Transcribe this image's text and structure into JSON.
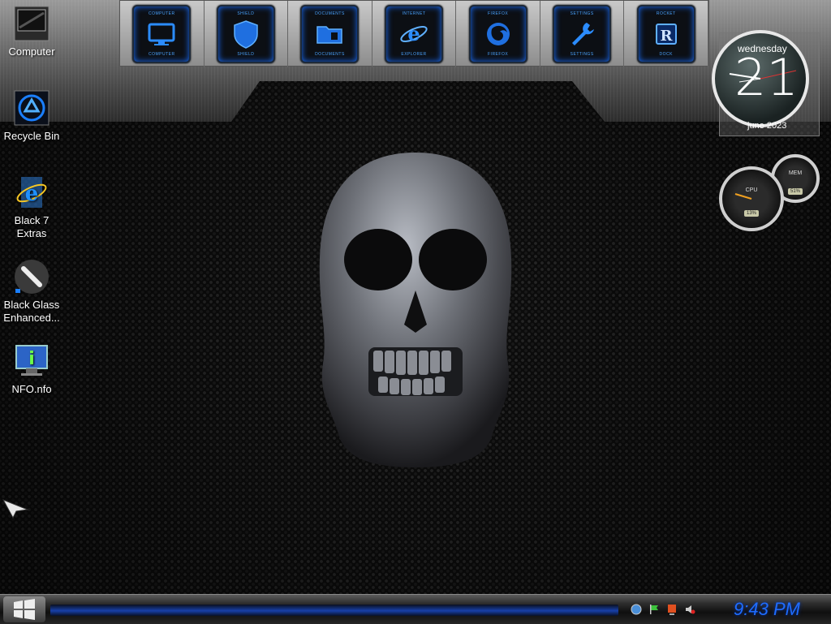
{
  "desktop": {
    "icons": [
      {
        "label": "Computer",
        "icon": "monitor-icon"
      },
      {
        "label": "Recycle Bin",
        "icon": "recycle-icon"
      },
      {
        "label": "Black 7 Extras",
        "icon": "internet-explorer-icon"
      },
      {
        "label": "Black Glass Enhanced...",
        "icon": "brush-icon"
      },
      {
        "label": "NFO.nfo",
        "icon": "info-monitor-icon"
      }
    ]
  },
  "dock": {
    "items": [
      {
        "top": "COMPUTER",
        "bottom": "COMPUTER",
        "icon": "monitor-icon"
      },
      {
        "top": "SHIELD",
        "bottom": "SHIELD",
        "icon": "shield-icon"
      },
      {
        "top": "DOCUMENTS",
        "bottom": "DOCUMENTS",
        "icon": "folder-icon"
      },
      {
        "top": "INTERNET",
        "bottom": "EXPLORER",
        "icon": "internet-explorer-icon"
      },
      {
        "top": "FIREFOX",
        "bottom": "FIREFOX",
        "icon": "firefox-icon"
      },
      {
        "top": "SETTINGS",
        "bottom": "SETTINGS",
        "icon": "wrench-icon"
      },
      {
        "top": "ROCKET",
        "bottom": "DOCK",
        "icon": "rocket-dock-icon"
      }
    ]
  },
  "clock": {
    "weekday": "wednesday",
    "day": "21",
    "month_year": "june 2023"
  },
  "meters": {
    "cpu_label": "CPU",
    "mem_label": "MEM",
    "cpu_value": "13%",
    "mem_value": "51%"
  },
  "taskbar": {
    "time": "9:43 PM"
  },
  "colors": {
    "accent": "#1e6cff",
    "dock_glow": "#1a6fff"
  }
}
